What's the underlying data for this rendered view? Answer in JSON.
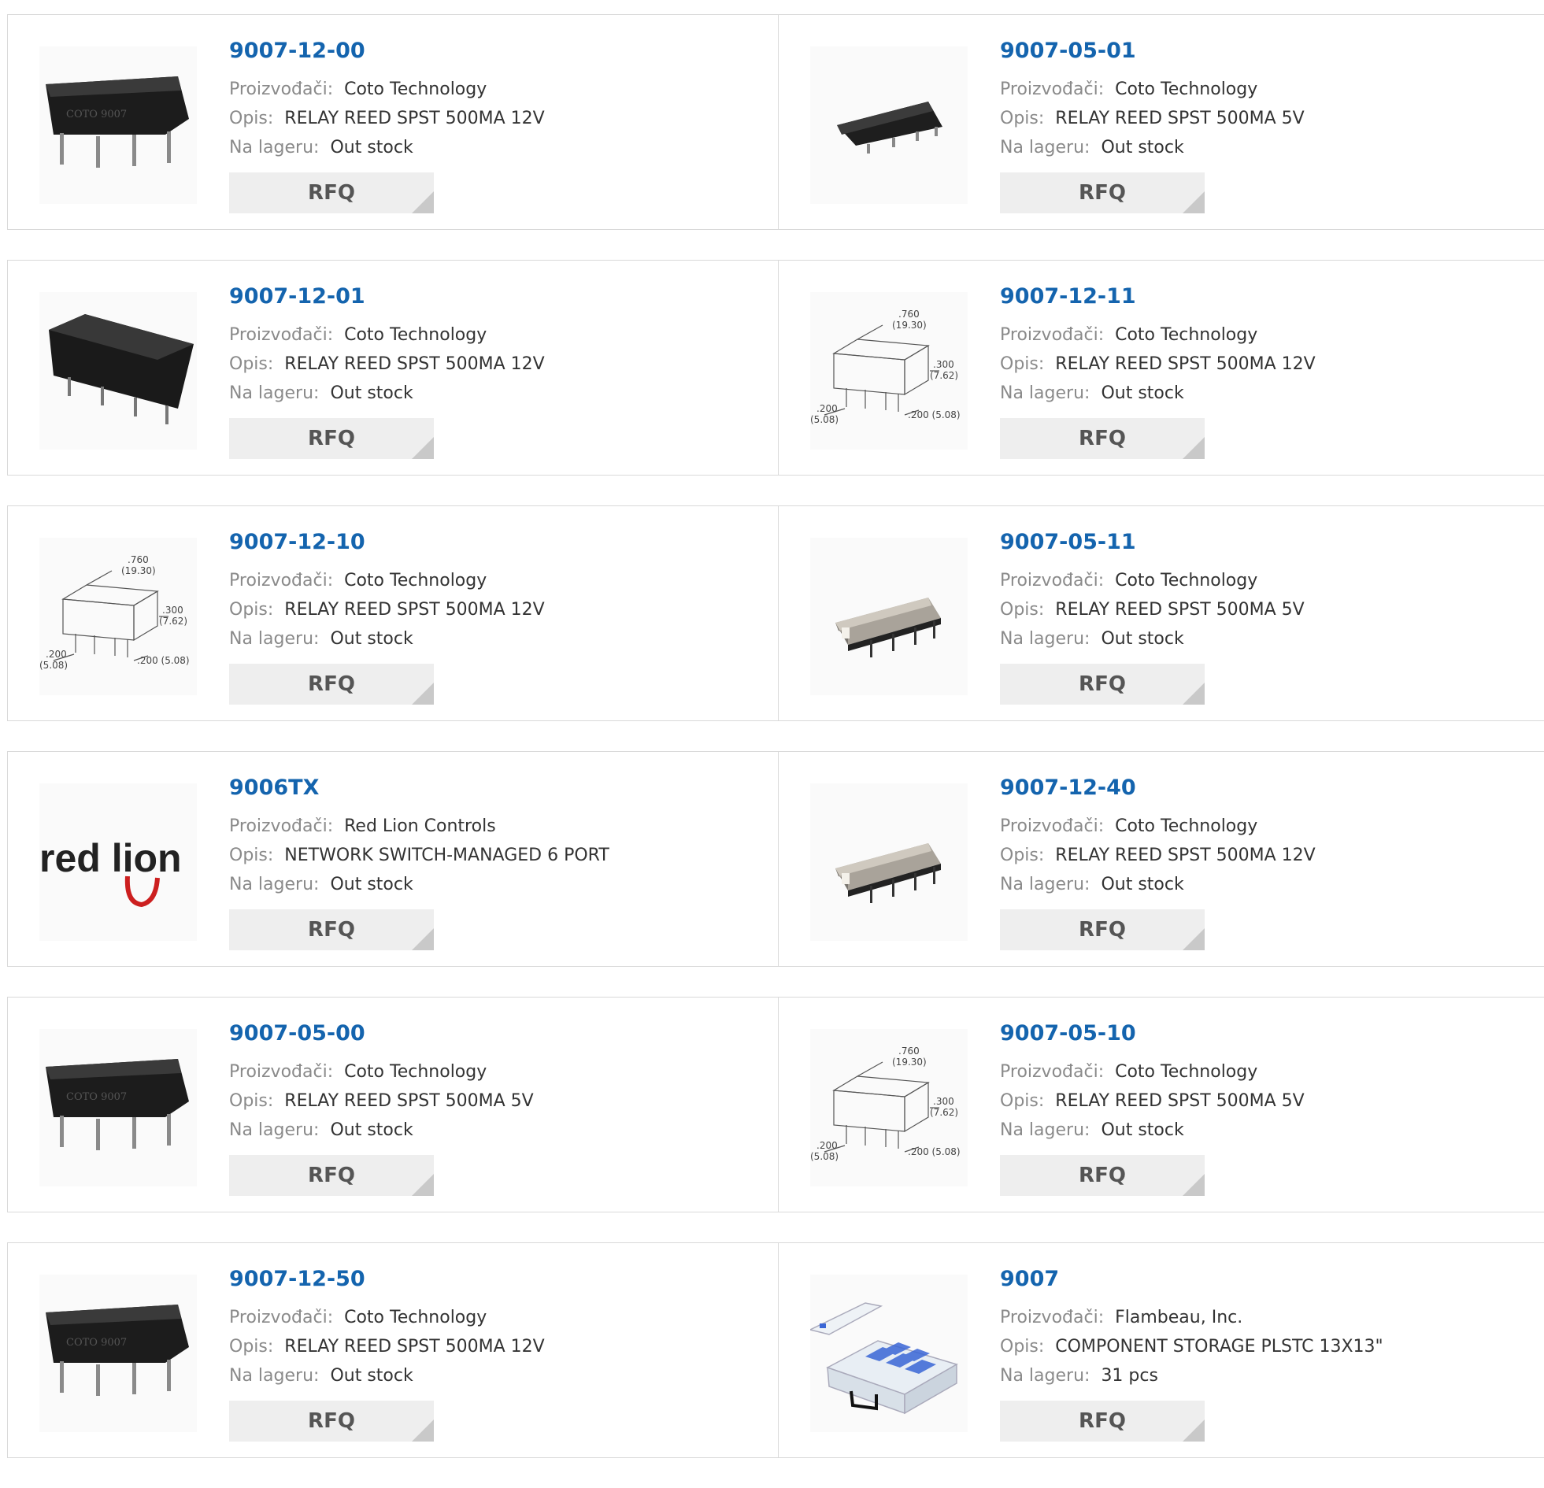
{
  "labels": {
    "manufacturer": "Proizvođači:",
    "description": "Opis:",
    "stock": "Na lageru:",
    "rfq": "RFQ"
  },
  "colors": {
    "part_link": "#1464ae",
    "label_gray": "#8a8a8a",
    "border": "#d9d9d9",
    "button_bg": "#eeeeee"
  },
  "products": [
    {
      "part": "9007-12-00",
      "manufacturer": "Coto Technology",
      "description": "RELAY REED SPST 500MA 12V",
      "stock": "Out stock",
      "image": "black-reed-relay-photo",
      "print": "COTO 9007"
    },
    {
      "part": "9007-05-01",
      "manufacturer": "Coto Technology",
      "description": "RELAY REED SPST 500MA 5V",
      "stock": "Out stock",
      "image": "small-black-relay-photo"
    },
    {
      "part": "9007-12-01",
      "manufacturer": "Coto Technology",
      "description": "RELAY REED SPST 500MA 12V",
      "stock": "Out stock",
      "image": "black-block-relay-photo"
    },
    {
      "part": "9007-12-11",
      "manufacturer": "Coto Technology",
      "description": "RELAY REED SPST 500MA 12V",
      "stock": "Out stock",
      "image": "relay-dimension-drawing",
      "dims": [
        ".760",
        "(19.30)",
        ".300",
        "(7.62)",
        ".200",
        "(5.08)",
        ".200 (5.08)"
      ]
    },
    {
      "part": "9007-12-10",
      "manufacturer": "Coto Technology",
      "description": "RELAY REED SPST 500MA 12V",
      "stock": "Out stock",
      "image": "relay-dimension-drawing",
      "dims": [
        ".760",
        "(19.30)",
        ".300",
        "(7.62)",
        ".200",
        "(5.08)",
        ".200 (5.08)"
      ]
    },
    {
      "part": "9007-05-11",
      "manufacturer": "Coto Technology",
      "description": "RELAY REED SPST 500MA 5V",
      "stock": "Out stock",
      "image": "metal-shield-relay-photo"
    },
    {
      "part": "9006TX",
      "manufacturer": "Red Lion Controls",
      "description": "NETWORK SWITCH-MANAGED 6 PORT",
      "stock": "Out stock",
      "image": "red-lion-logo",
      "logo_text": "red lion"
    },
    {
      "part": "9007-12-40",
      "manufacturer": "Coto Technology",
      "description": "RELAY REED SPST 500MA 12V",
      "stock": "Out stock",
      "image": "metal-shield-relay-photo"
    },
    {
      "part": "9007-05-00",
      "manufacturer": "Coto Technology",
      "description": "RELAY REED SPST 500MA 5V",
      "stock": "Out stock",
      "image": "black-reed-relay-photo",
      "print": "COTO 9007"
    },
    {
      "part": "9007-05-10",
      "manufacturer": "Coto Technology",
      "description": "RELAY REED SPST 500MA 5V",
      "stock": "Out stock",
      "image": "relay-dimension-drawing",
      "dims": [
        ".760",
        "(19.30)",
        ".300",
        "(7.62)",
        ".200",
        "(5.08)",
        ".200 (5.08)"
      ]
    },
    {
      "part": "9007-12-50",
      "manufacturer": "Coto Technology",
      "description": "RELAY REED SPST 500MA 12V",
      "stock": "Out stock",
      "image": "black-reed-relay-photo",
      "print": "COTO 9007"
    },
    {
      "part": "9007",
      "manufacturer": "Flambeau, Inc.",
      "description": "COMPONENT STORAGE PLSTC 13X13\"",
      "stock": "31 pcs",
      "image": "storage-box-photo"
    }
  ]
}
